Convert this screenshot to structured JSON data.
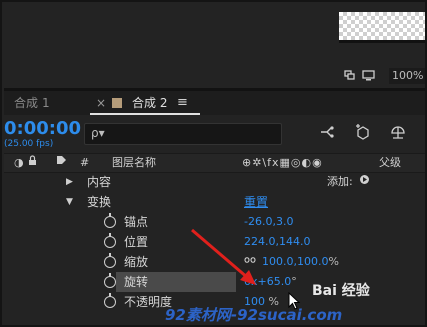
{
  "viewer": {
    "zoom": "100%",
    "icons": [
      "snapshot-icon",
      "monitor-icon"
    ]
  },
  "tabs": [
    {
      "label": "合成",
      "number": "1"
    },
    {
      "label": "合成",
      "number": "2",
      "close": "×",
      "menu": "≡"
    }
  ],
  "comp": {
    "timecode": "0:00:00",
    "fps": "(25.00 fps)",
    "search_icon": "ρ▾"
  },
  "columns": {
    "layer_name": "图层名称",
    "hash": "#",
    "parent": "父级"
  },
  "rows": {
    "content": {
      "label": "内容",
      "add_label": "添加:"
    },
    "transform": {
      "label": "变换",
      "reset": "重置"
    },
    "anchor": {
      "label": "锚点",
      "value": "-26.0,3.0"
    },
    "position": {
      "label": "位置",
      "value": "224.0,144.0"
    },
    "scale": {
      "label": "缩放",
      "value": "100.0,100.0",
      "unit": "%"
    },
    "rotation": {
      "label": "旋转",
      "value": "0x+65.0",
      "unit": "°"
    },
    "opacity": {
      "label": "不透明度",
      "value": "100",
      "unit": "%"
    }
  },
  "watermarks": {
    "site": "92素材网-92sucai.com",
    "baidu": "Bai 经验"
  },
  "colors": {
    "accent_blue": "#2f8df0",
    "panel_bg": "#232323",
    "arrow_red": "#e0201c"
  }
}
